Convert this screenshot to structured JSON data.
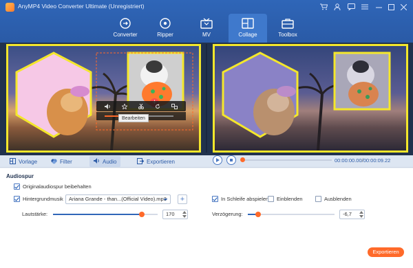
{
  "window": {
    "title": "AnyMP4 Video Converter Ultimate (Unregistriert)"
  },
  "nav": [
    {
      "label": "Converter",
      "icon": "converter-icon"
    },
    {
      "label": "Ripper",
      "icon": "ripper-icon"
    },
    {
      "label": "MV",
      "icon": "mv-icon"
    },
    {
      "label": "Collage",
      "icon": "collage-icon",
      "active": true
    },
    {
      "label": "Toolbox",
      "icon": "toolbox-icon"
    }
  ],
  "preview": {
    "edit_tooltip": "Bearbeiten",
    "clip_volume_fraction": 0.45
  },
  "tabs": [
    {
      "label": "Vorlage",
      "icon": "template-icon"
    },
    {
      "label": "Filter",
      "icon": "filter-icon"
    },
    {
      "label": "Audio",
      "icon": "audio-icon",
      "active": true
    },
    {
      "label": "Exportieren",
      "icon": "export-icon"
    }
  ],
  "playback": {
    "current_time": "00:00:00.00",
    "total_time": "00:00:09.22",
    "progress_fraction": 0.0
  },
  "audio": {
    "section_title": "Audiospur",
    "keep_original_label": "Originalaudiospur beibehalten",
    "keep_original_checked": true,
    "background_music_label": "Hintergrundmusik",
    "background_music_checked": true,
    "music_file": "Ariana Grande - than...(Official Video).mp3",
    "loop_label": "In Schleife abspielen",
    "loop_checked": true,
    "fade_in_label": "Einblenden",
    "fade_in_checked": false,
    "fade_out_label": "Ausblenden",
    "fade_out_checked": false,
    "volume_label": "Lautstärke:",
    "volume_value": "170",
    "volume_fraction": 0.85,
    "delay_label": "Verzögerung:",
    "delay_value": "-6,7",
    "delay_fraction": 0.12
  },
  "export_button": "Exportieren",
  "colors": {
    "brand_blue": "#2f66b8",
    "accent_orange": "#ff6a2a",
    "frame_yellow": "#f4e72b"
  }
}
